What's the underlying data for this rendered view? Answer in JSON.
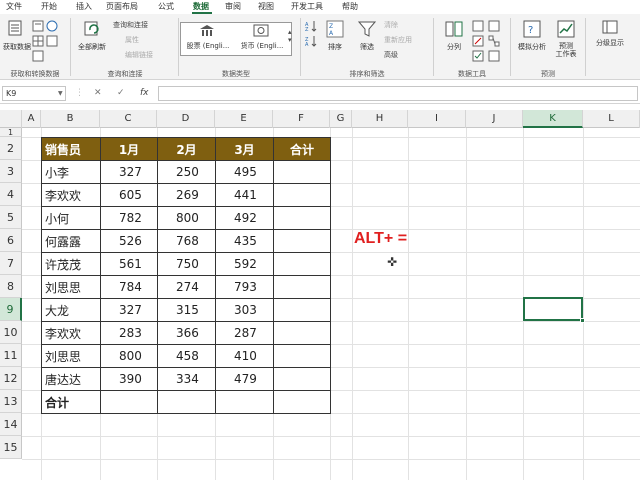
{
  "menu": {
    "tabs": [
      "文件",
      "开始",
      "插入",
      "页面布局",
      "公式",
      "数据",
      "审阅",
      "视图",
      "开发工具",
      "帮助"
    ],
    "active": "数据"
  },
  "ribbon": {
    "get_data": "获取数据",
    "refresh_all": "全部刷新",
    "queries_connections": "查询和连接",
    "properties": "属性",
    "edit_links": "编辑链接",
    "stocks": "股票 (Engli...",
    "currency": "货币 (Engli...",
    "sort": "排序",
    "filter": "筛选",
    "clear": "清除",
    "reapply": "重新应用",
    "advanced": "高级",
    "text_to_columns": "分列",
    "what_if": "模拟分析",
    "forecast_sheet": "预测\n工作表",
    "outline": "分级显示",
    "groups": {
      "get_transform": "获取和转换数据",
      "queries": "查询和连接",
      "data_types": "数据类型",
      "sort_filter": "排序和筛选",
      "data_tools": "数据工具",
      "forecast": "预测"
    }
  },
  "formula_bar": {
    "name_box": "K9",
    "cancel": "✕",
    "enter": "✓",
    "fx": "fx",
    "value": ""
  },
  "columns": [
    "A",
    "B",
    "C",
    "D",
    "E",
    "F",
    "G",
    "H",
    "I",
    "J",
    "K",
    "L"
  ],
  "rows": [
    "1",
    "2",
    "3",
    "4",
    "5",
    "6",
    "7",
    "8",
    "9",
    "10",
    "11",
    "12",
    "13",
    "14",
    "15"
  ],
  "table": {
    "headers": [
      "销售员",
      "1月",
      "2月",
      "3月",
      "合计"
    ],
    "rows": [
      [
        "小李",
        "327",
        "250",
        "495",
        ""
      ],
      [
        "李欢欢",
        "605",
        "269",
        "441",
        ""
      ],
      [
        "小何",
        "782",
        "800",
        "492",
        ""
      ],
      [
        "何露露",
        "526",
        "768",
        "435",
        ""
      ],
      [
        "许茂茂",
        "561",
        "750",
        "592",
        ""
      ],
      [
        "刘思思",
        "784",
        "274",
        "793",
        ""
      ],
      [
        "大龙",
        "327",
        "315",
        "303",
        ""
      ],
      [
        "李欢欢",
        "283",
        "366",
        "287",
        ""
      ],
      [
        "刘思思",
        "800",
        "458",
        "410",
        ""
      ],
      [
        "唐达达",
        "390",
        "334",
        "479",
        ""
      ]
    ],
    "total_row": [
      "合计",
      "",
      "",
      "",
      ""
    ]
  },
  "annotation": "ALT+ =",
  "active_cell": "K9",
  "colors": {
    "header_fill": "#7f5f10",
    "accent": "#217346",
    "annotation": "#e02020"
  }
}
